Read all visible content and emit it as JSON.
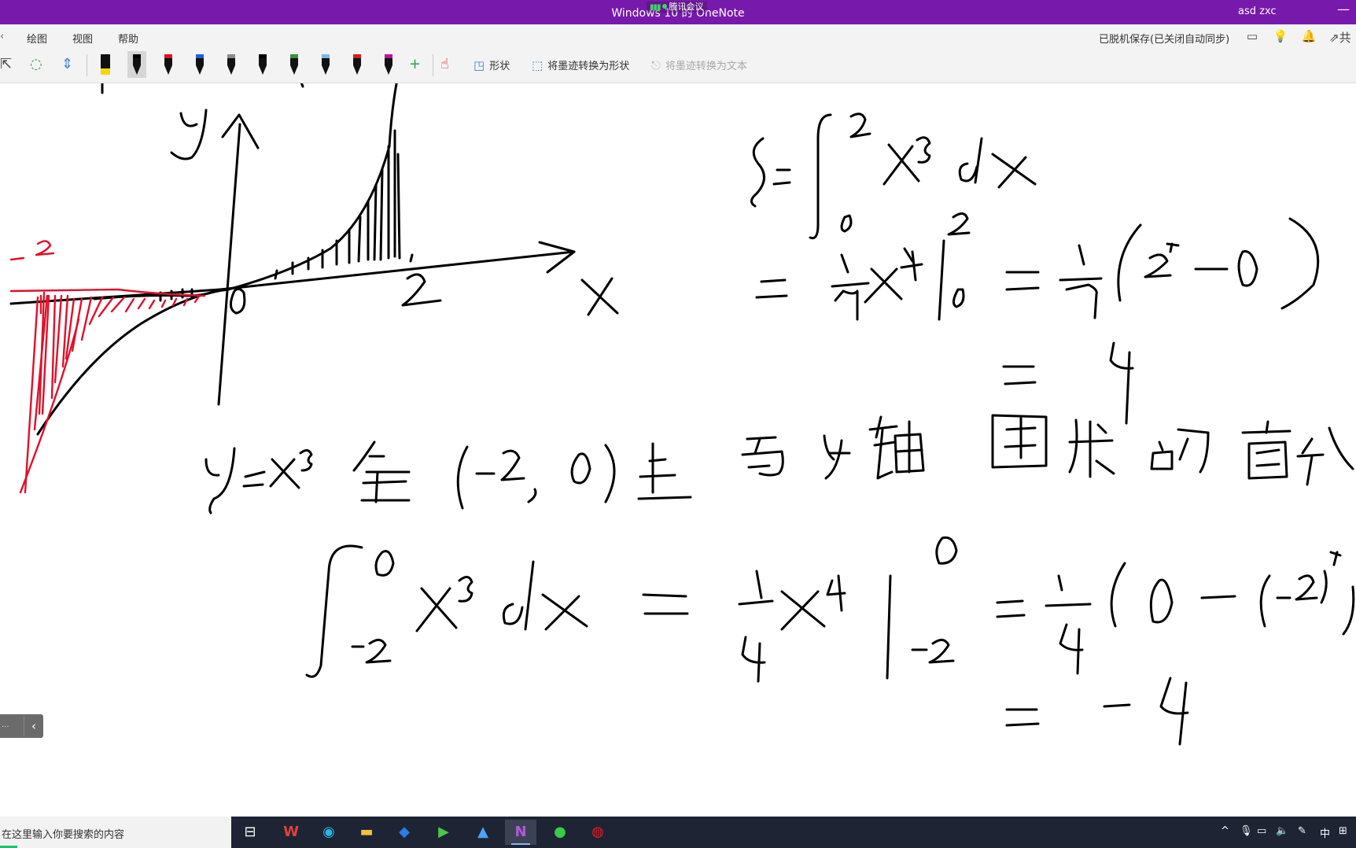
{
  "window": {
    "title": "Windows 10 的 OneNote",
    "meeting_badge": "腾讯会议",
    "user": "asd zxc",
    "minimize": "—"
  },
  "ribbon": {
    "tabs": [
      {
        "label": "绘图",
        "active": true
      },
      {
        "label": "视图",
        "active": false
      },
      {
        "label": "帮助",
        "active": false
      }
    ],
    "sync_status": "已脱机保存(已关闭自动同步)",
    "share_label": "共"
  },
  "toolbar": {
    "pens": [
      {
        "name": "highlighter-yellow",
        "color": "#f2d800"
      },
      {
        "name": "pen-black-selected",
        "color": "#000000"
      },
      {
        "name": "pen-red",
        "color": "#e0102a"
      },
      {
        "name": "pen-blue",
        "color": "#1f63d1"
      },
      {
        "name": "pen-gray",
        "color": "#8a8a8a"
      },
      {
        "name": "pen-black-wide",
        "color": "#000000"
      },
      {
        "name": "pen-galaxy",
        "color": "#3a8f3a"
      },
      {
        "name": "pen-lightblue",
        "color": "#7bb6e8"
      },
      {
        "name": "pen-red-2",
        "color": "#d81c1c"
      },
      {
        "name": "pen-magenta",
        "color": "#c0119f"
      }
    ],
    "shapes_label": "形状",
    "ink_to_shape_label": "将墨迹转换为形状",
    "ink_to_text_label": "将墨迹转换为文本"
  },
  "side_panel": {
    "label": "..."
  },
  "taskbar": {
    "search_placeholder": "在这里输入你要搜索的内容",
    "input_method": "中",
    "apps": [
      "task-view",
      "wps",
      "edge",
      "file-explorer",
      "sogou",
      "video-player",
      "photos",
      "onenote",
      "wechat",
      "recorder"
    ]
  }
}
